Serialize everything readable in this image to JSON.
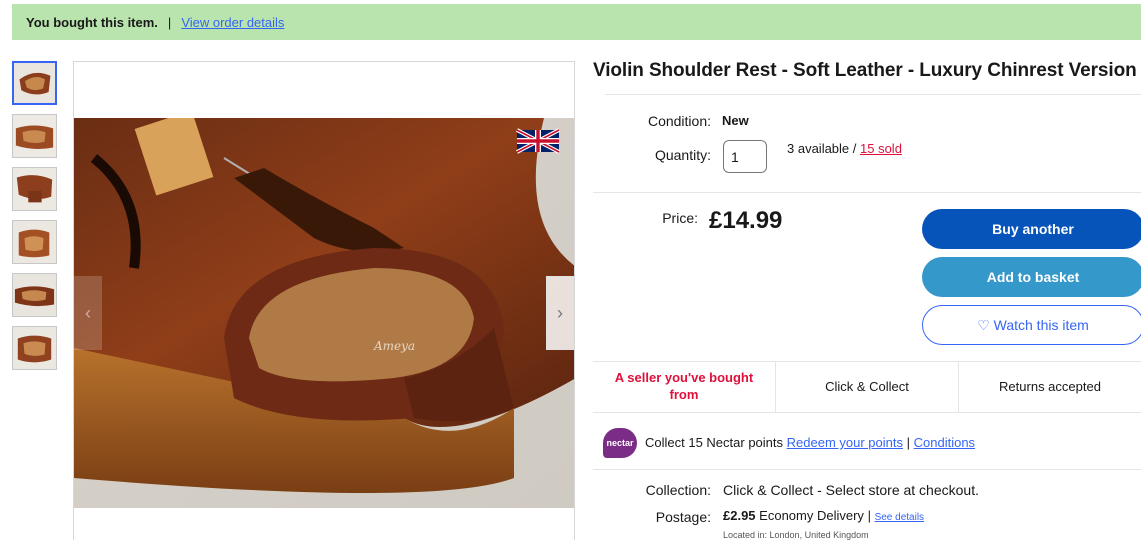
{
  "banner": {
    "bought_text": "You bought this item.",
    "separator": "|",
    "order_link": "View order details"
  },
  "gallery": {
    "thumbnails": [
      "thumb-1",
      "thumb-2",
      "thumb-3",
      "thumb-4",
      "thumb-5",
      "thumb-6"
    ],
    "active_index": 0,
    "watermark": "Ameya",
    "prev_arrow": "‹",
    "next_arrow": "›"
  },
  "item": {
    "title": "Violin Shoulder Rest - Soft Leather - Luxury Chinrest Version",
    "condition_label": "Condition:",
    "condition_value": "New",
    "quantity_label": "Quantity:",
    "quantity_value": "1",
    "available_text": "3 available / ",
    "sold_text": "15 sold",
    "price_label": "Price:",
    "price_value": "£14.99"
  },
  "actions": {
    "buy_another": "Buy another",
    "add_to_basket": "Add to basket",
    "watch_icon": "♡",
    "watch_label": "Watch this item"
  },
  "features": {
    "seller": "A seller you've bought from",
    "click_collect": "Click & Collect",
    "returns": "Returns accepted"
  },
  "nectar": {
    "logo_text": "nectar",
    "collect_text": "Collect 15 Nectar points",
    "redeem_link": "Redeem your points",
    "pipe": "|",
    "conditions_link": "Conditions"
  },
  "shipping": {
    "collection_label": "Collection:",
    "collection_value": "Click & Collect - Select store at checkout.",
    "postage_label": "Postage:",
    "postage_price": "£2.95",
    "postage_method": "Economy Delivery",
    "postage_pipe": "|",
    "see_details": "See details",
    "located": "Located in: London, United Kingdom"
  },
  "colors": {
    "banner_bg": "#b9e4ad",
    "link": "#3665f3",
    "sold_red": "#e0103a",
    "buy_btn": "#0654ba",
    "basket_btn": "#3498ca",
    "nectar_purple": "#7b2c86"
  }
}
